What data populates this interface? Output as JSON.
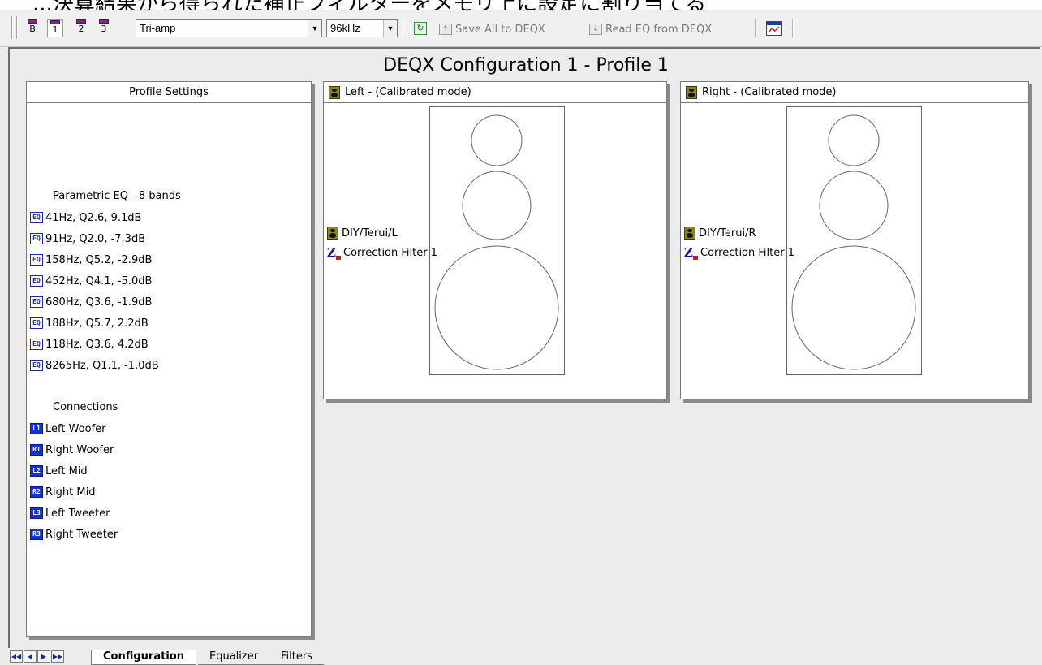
{
  "top_text": "...決算結果から得られた補正フィルターをメモリ上に設定に割り当てる",
  "toolbar": {
    "buttons": [
      {
        "label": "B"
      },
      {
        "label": "1"
      },
      {
        "label": "2"
      },
      {
        "label": "3"
      }
    ],
    "amp_mode": {
      "value": "Tri-amp"
    },
    "sample_rate": {
      "value": "96kHz"
    },
    "save_label": "Save All to DEQX",
    "read_label": "Read EQ from DEQX"
  },
  "config_title": "DEQX Configuration 1 - Profile 1",
  "profile_settings": {
    "header": "Profile Settings",
    "eq_heading": "Parametric EQ - 8 bands",
    "eq_icon_text": "EQ",
    "eq_bands": [
      "41Hz, Q2.6, 9.1dB",
      "91Hz, Q2.0, -7.3dB",
      "158Hz, Q5.2, -2.9dB",
      "452Hz, Q4.1, -5.0dB",
      "680Hz, Q3.6, -1.9dB",
      "188Hz, Q5.7, 2.2dB",
      "118Hz, Q3.6, 4.2dB",
      "8265Hz, Q1.1, -1.0dB"
    ],
    "connections_heading": "Connections",
    "connections": [
      {
        "code": "L1",
        "label": "Left Woofer"
      },
      {
        "code": "R1",
        "label": "Right Woofer"
      },
      {
        "code": "L2",
        "label": "Left Mid"
      },
      {
        "code": "R2",
        "label": "Right Mid"
      },
      {
        "code": "L3",
        "label": "Left Tweeter"
      },
      {
        "code": "R3",
        "label": "Right Tweeter"
      }
    ]
  },
  "left_channel": {
    "header": "Left -  (Calibrated mode)",
    "speaker": "DIY/Terui/L",
    "filter": "Correction Filter 1"
  },
  "right_channel": {
    "header": "Right -  (Calibrated mode)",
    "speaker": "DIY/Terui/R",
    "filter": "Correction Filter 1"
  },
  "tabs": [
    {
      "label": "Configuration",
      "active": true
    },
    {
      "label": "Equalizer",
      "active": false
    },
    {
      "label": "Filters",
      "active": false
    }
  ],
  "nav_icons": [
    "first-icon",
    "prev-icon",
    "next-icon",
    "last-icon"
  ]
}
